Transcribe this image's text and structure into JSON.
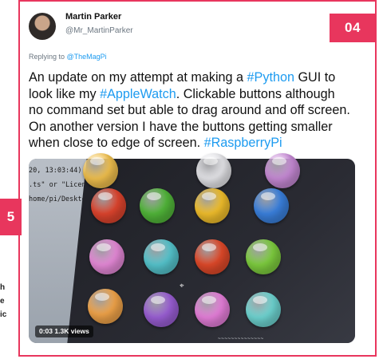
{
  "badges": {
    "main": "04",
    "side": "5"
  },
  "left_fragments": [
    "h",
    "e",
    "ic"
  ],
  "tweet": {
    "author_name": "Martin Parker",
    "author_handle": "@Mr_MartinParker",
    "reply_prefix": "Replying to ",
    "reply_handle": "@TheMagPi",
    "segments": [
      {
        "text": "An update on my attempt at making a ",
        "tag": false
      },
      {
        "text": "#Python",
        "tag": true
      },
      {
        "text": " GUI to look like my ",
        "tag": false
      },
      {
        "text": "#AppleWatch",
        "tag": true
      },
      {
        "text": ". Clickable buttons although no command set but able to drag around and off screen. On another version I have the buttons getting smaller when close to edge of screen. ",
        "tag": false
      },
      {
        "text": "#RaspberryPi",
        "tag": true
      }
    ]
  },
  "video": {
    "terminal_lines": [
      "20, 13:03:44)",
      ".ts\" or \"License",
      "home/pi/Desktop/"
    ],
    "views_label": "0:03  1.3K views",
    "footer_text": "~~~~~~~~~~~~~~",
    "colors": {
      "accent": "#e8365d",
      "link": "#1d9bf0"
    },
    "balls": [
      {
        "name": "ball-top-partial-1",
        "color": "#f2c14e"
      },
      {
        "name": "ball-top-partial-2",
        "color": "#e6e6ea"
      },
      {
        "name": "ball-top-partial-3",
        "color": "#c78ad6"
      },
      {
        "name": "ball-red",
        "color": "#e0452e"
      },
      {
        "name": "ball-green",
        "color": "#52b83a"
      },
      {
        "name": "ball-yellow",
        "color": "#f3c02c"
      },
      {
        "name": "ball-blue",
        "color": "#3b82e0"
      },
      {
        "name": "ball-pink",
        "color": "#e78ad9"
      },
      {
        "name": "ball-cyan",
        "color": "#56c6cf"
      },
      {
        "name": "ball-red-2",
        "color": "#e24a2a"
      },
      {
        "name": "ball-green-2",
        "color": "#7fcf3f"
      },
      {
        "name": "ball-orange",
        "color": "#f3a54a"
      },
      {
        "name": "ball-purple",
        "color": "#9b5fd6"
      },
      {
        "name": "ball-magenta",
        "color": "#e77fdb"
      },
      {
        "name": "ball-teal",
        "color": "#6fd6d3"
      }
    ]
  }
}
